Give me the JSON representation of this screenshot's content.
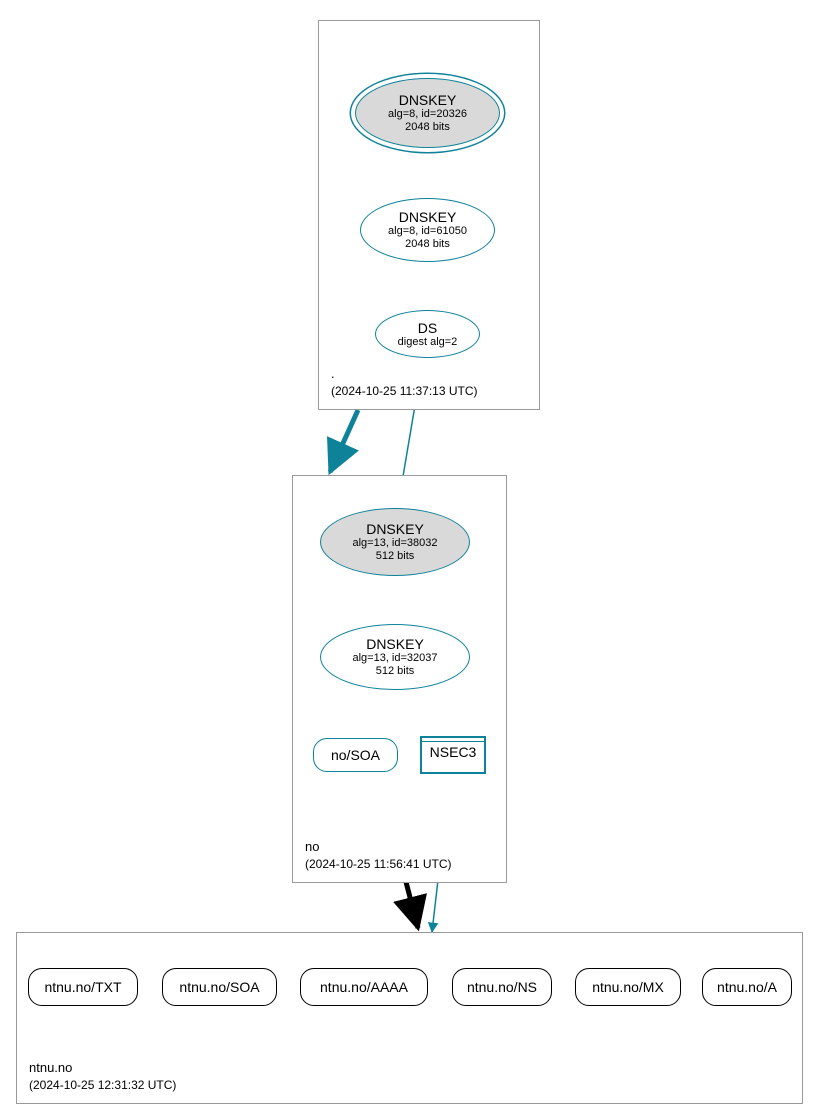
{
  "zones": {
    "root": {
      "name": ".",
      "timestamp": "(2024-10-25 11:37:13 UTC)",
      "dnskey_ksk": {
        "title": "DNSKEY",
        "sub1": "alg=8, id=20326",
        "sub2": "2048 bits"
      },
      "dnskey_zsk": {
        "title": "DNSKEY",
        "sub1": "alg=8, id=61050",
        "sub2": "2048 bits"
      },
      "ds": {
        "title": "DS",
        "sub1": "digest alg=2"
      }
    },
    "no": {
      "name": "no",
      "timestamp": "(2024-10-25 11:56:41 UTC)",
      "dnskey_ksk": {
        "title": "DNSKEY",
        "sub1": "alg=13, id=38032",
        "sub2": "512 bits"
      },
      "dnskey_zsk": {
        "title": "DNSKEY",
        "sub1": "alg=13, id=32037",
        "sub2": "512 bits"
      },
      "soa": {
        "label": "no/SOA"
      },
      "nsec3": {
        "label": "NSEC3"
      }
    },
    "ntnu": {
      "name": "ntnu.no",
      "timestamp": "(2024-10-25 12:31:32 UTC)",
      "records": [
        "ntnu.no/TXT",
        "ntnu.no/SOA",
        "ntnu.no/AAAA",
        "ntnu.no/NS",
        "ntnu.no/MX",
        "ntnu.no/A"
      ]
    }
  }
}
